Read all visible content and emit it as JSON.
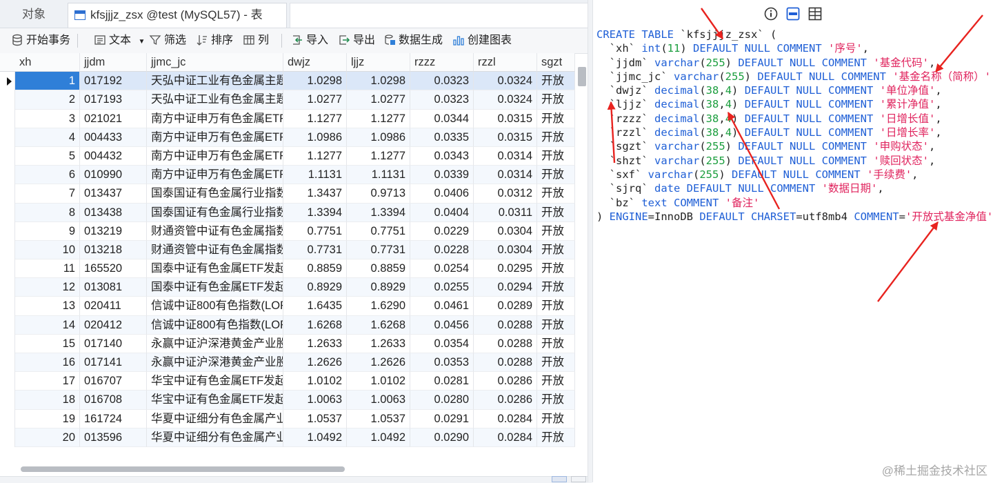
{
  "tabs": {
    "objects": "对象",
    "table": "kfsjjjz_zsx @test (MySQL57) - 表"
  },
  "toolbar": {
    "begin_tx": "开始事务",
    "text": "文本",
    "filter": "筛选",
    "sort": "排序",
    "columns": "列",
    "import": "导入",
    "export": "导出",
    "data_gen": "数据生成",
    "create_chart": "创建图表"
  },
  "grid": {
    "columns": [
      "xh",
      "jjdm",
      "jjmc_jc",
      "dwjz",
      "ljjz",
      "rzzz",
      "rzzl",
      "sgzt"
    ],
    "rows": [
      [
        "1",
        "017192",
        "天弘中证工业有色金属主题",
        "1.0298",
        "1.0298",
        "0.0323",
        "0.0324",
        "开放"
      ],
      [
        "2",
        "017193",
        "天弘中证工业有色金属主题",
        "1.0277",
        "1.0277",
        "0.0323",
        "0.0324",
        "开放"
      ],
      [
        "3",
        "021021",
        "南方中证申万有色金属ETF",
        "1.1277",
        "1.1277",
        "0.0344",
        "0.0315",
        "开放"
      ],
      [
        "4",
        "004433",
        "南方中证申万有色金属ETF",
        "1.0986",
        "1.0986",
        "0.0335",
        "0.0315",
        "开放"
      ],
      [
        "5",
        "004432",
        "南方中证申万有色金属ETF",
        "1.1277",
        "1.1277",
        "0.0343",
        "0.0314",
        "开放"
      ],
      [
        "6",
        "010990",
        "南方中证申万有色金属ETF",
        "1.1131",
        "1.1131",
        "0.0339",
        "0.0314",
        "开放"
      ],
      [
        "7",
        "013437",
        "国泰国证有色金属行业指数",
        "1.3437",
        "0.9713",
        "0.0406",
        "0.0312",
        "开放"
      ],
      [
        "8",
        "013438",
        "国泰国证有色金属行业指数",
        "1.3394",
        "1.3394",
        "0.0404",
        "0.0311",
        "开放"
      ],
      [
        "9",
        "013219",
        "财通资管中证有色金属指数",
        "0.7751",
        "0.7751",
        "0.0229",
        "0.0304",
        "开放"
      ],
      [
        "10",
        "013218",
        "财通资管中证有色金属指数",
        "0.7731",
        "0.7731",
        "0.0228",
        "0.0304",
        "开放"
      ],
      [
        "11",
        "165520",
        "国泰中证有色金属ETF发起",
        "0.8859",
        "0.8859",
        "0.0254",
        "0.0295",
        "开放"
      ],
      [
        "12",
        "013081",
        "国泰中证有色金属ETF发起",
        "0.8929",
        "0.8929",
        "0.0255",
        "0.0294",
        "开放"
      ],
      [
        "13",
        "020411",
        "信诚中证800有色指数(LOF",
        "1.6435",
        "1.6290",
        "0.0461",
        "0.0289",
        "开放"
      ],
      [
        "14",
        "020412",
        "信诚中证800有色指数(LOF",
        "1.6268",
        "1.6268",
        "0.0456",
        "0.0288",
        "开放"
      ],
      [
        "15",
        "017140",
        "永赢中证沪深港黄金产业股",
        "1.2633",
        "1.2633",
        "0.0354",
        "0.0288",
        "开放"
      ],
      [
        "16",
        "017141",
        "永赢中证沪深港黄金产业股",
        "1.2626",
        "1.2626",
        "0.0353",
        "0.0288",
        "开放"
      ],
      [
        "17",
        "016707",
        "华宝中证有色金属ETF发起",
        "1.0102",
        "1.0102",
        "0.0281",
        "0.0286",
        "开放"
      ],
      [
        "18",
        "016708",
        "华宝中证有色金属ETF发起",
        "1.0063",
        "1.0063",
        "0.0280",
        "0.0286",
        "开放"
      ],
      [
        "19",
        "161724",
        "华夏中证细分有色金属产业",
        "1.0537",
        "1.0537",
        "0.0291",
        "0.0284",
        "开放"
      ],
      [
        "20",
        "013596",
        "华夏中证细分有色金属产业",
        "1.0492",
        "1.0492",
        "0.0290",
        "0.0284",
        "开放"
      ]
    ]
  },
  "ddl": {
    "l0a": "CREATE TABLE",
    "l0b": " `kfsjjjz_zsx` (",
    "l1": [
      "  `xh` ",
      "int",
      "(",
      "11",
      ") ",
      "DEFAULT NULL COMMENT",
      " ",
      "'序号'",
      ","
    ],
    "l2": [
      "  `jjdm` ",
      "varchar",
      "(",
      "255",
      ") ",
      "DEFAULT NULL COMMENT",
      " ",
      "'基金代码'",
      ","
    ],
    "l3": [
      "  `jjmc_jc` ",
      "varchar",
      "(",
      "255",
      ") ",
      "DEFAULT NULL COMMENT",
      " ",
      "'基金名称（简称）'",
      ","
    ],
    "l4": [
      "  `dwjz` ",
      "decimal",
      "(",
      "38",
      ",",
      "4",
      ") ",
      "DEFAULT NULL COMMENT",
      " ",
      "'单位净值'",
      ","
    ],
    "l5": [
      "  `ljjz` ",
      "decimal",
      "(",
      "38",
      ",",
      "4",
      ") ",
      "DEFAULT NULL COMMENT",
      " ",
      "'累计净值'",
      ","
    ],
    "l6": [
      "  `rzzz` ",
      "decimal",
      "(",
      "38",
      ",",
      "4",
      ") ",
      "DEFAULT NULL COMMENT",
      " ",
      "'日增长值'",
      ","
    ],
    "l7": [
      "  `rzzl` ",
      "decimal",
      "(",
      "38",
      ",",
      "4",
      ") ",
      "DEFAULT NULL COMMENT",
      " ",
      "'日增长率'",
      ","
    ],
    "l8": [
      "  `sgzt` ",
      "varchar",
      "(",
      "255",
      ") ",
      "DEFAULT NULL COMMENT",
      " ",
      "'申购状态'",
      ","
    ],
    "l9": [
      "  `shzt` ",
      "varchar",
      "(",
      "255",
      ") ",
      "DEFAULT NULL COMMENT",
      " ",
      "'赎回状态'",
      ","
    ],
    "l10": [
      "  `sxf` ",
      "varchar",
      "(",
      "255",
      ") ",
      "DEFAULT NULL COMMENT",
      " ",
      "'手续费'",
      ","
    ],
    "l11": [
      "  `sjrq` ",
      "date",
      " ",
      "DEFAULT NULL COMMENT",
      " ",
      "'数据日期'",
      ","
    ],
    "l12": [
      "  `bz` ",
      "text",
      " ",
      "COMMENT",
      " ",
      "'备注'"
    ],
    "l13": [
      ") ",
      "ENGINE",
      "=InnoDB ",
      "DEFAULT CHARSET",
      "=utf8mb4 ",
      "COMMENT",
      "=",
      "'开放式基金净值'"
    ]
  },
  "watermark": "@稀土掘金技术社区"
}
